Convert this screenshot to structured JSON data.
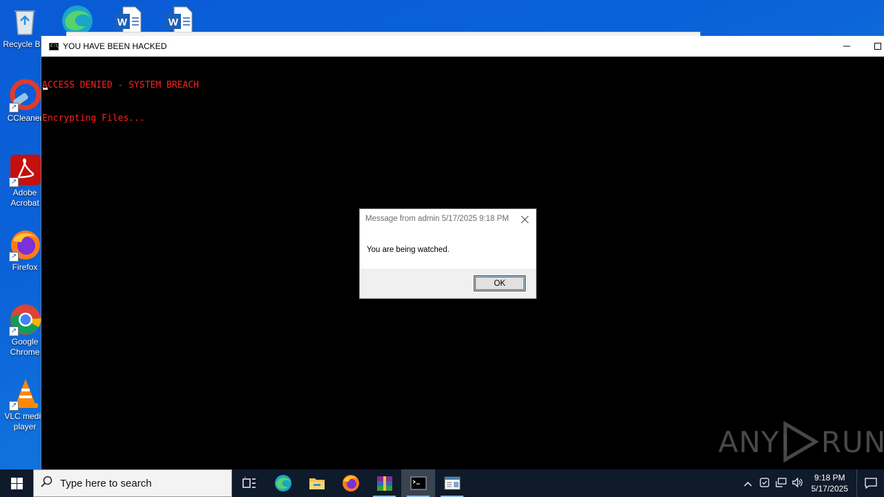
{
  "desktop": {
    "icons": [
      {
        "label": "Recycle Bin",
        "icon": "recycle-bin-icon"
      },
      {
        "label": "CCleaner",
        "icon": "ccleaner-icon"
      },
      {
        "label": "Adobe Acrobat",
        "icon": "adobe-acrobat-icon"
      },
      {
        "label": "Firefox",
        "icon": "firefox-icon"
      },
      {
        "label": "Google Chrome",
        "icon": "google-chrome-icon"
      },
      {
        "label": "VLC media player",
        "icon": "vlc-icon"
      }
    ],
    "top_icons": [
      "edge-icon",
      "word-document-icon",
      "word-document-icon"
    ]
  },
  "console": {
    "title": "YOU HAVE BEEN HACKED",
    "lines": [
      "ACCESS DENIED - SYSTEM BREACH",
      "Encrypting Files..."
    ],
    "text_color": "#ff2020"
  },
  "message_box": {
    "title": "Message from admin 5/17/2025 9:18 PM",
    "text": "You are being watched.",
    "ok_label": "OK"
  },
  "watermark": {
    "left": "ANY",
    "right": "RUN"
  },
  "taskbar": {
    "search_placeholder": "Type here to search",
    "apps": [
      "task-view-icon",
      "edge-icon",
      "file-explorer-icon",
      "firefox-icon",
      "winrar-icon",
      "cmd-icon",
      "app-window-icon"
    ],
    "active_app": "cmd-icon",
    "clock_time": "9:18 PM",
    "clock_date": "5/17/2025"
  }
}
